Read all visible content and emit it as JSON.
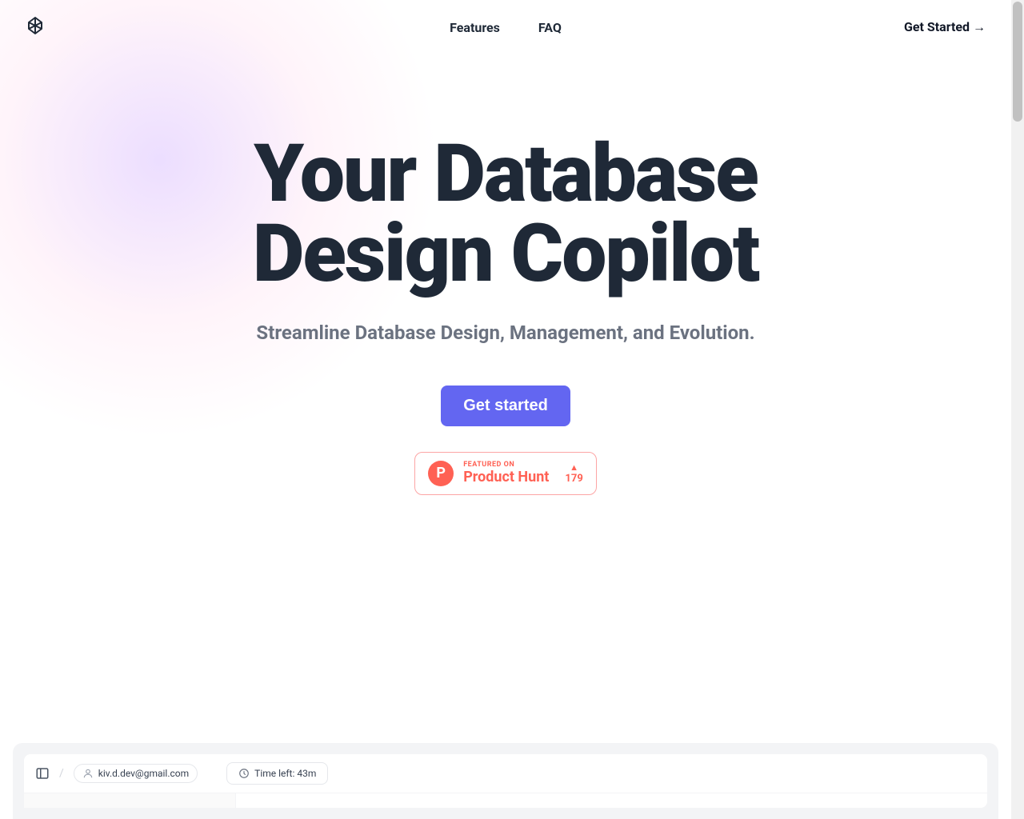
{
  "nav": {
    "features": "Features",
    "faq": "FAQ",
    "cta": "Get Started →"
  },
  "hero": {
    "title": "Your Database Design Copilot",
    "subtitle": "Streamline Database Design, Management, and Evolution.",
    "cta": "Get started"
  },
  "product_hunt": {
    "featured": "FEATURED ON",
    "name": "Product Hunt",
    "votes": "179",
    "logo_letter": "P"
  },
  "preview": {
    "user_email": "kiv.d.dev@gmail.com",
    "time_left": "Time left: 43m"
  }
}
